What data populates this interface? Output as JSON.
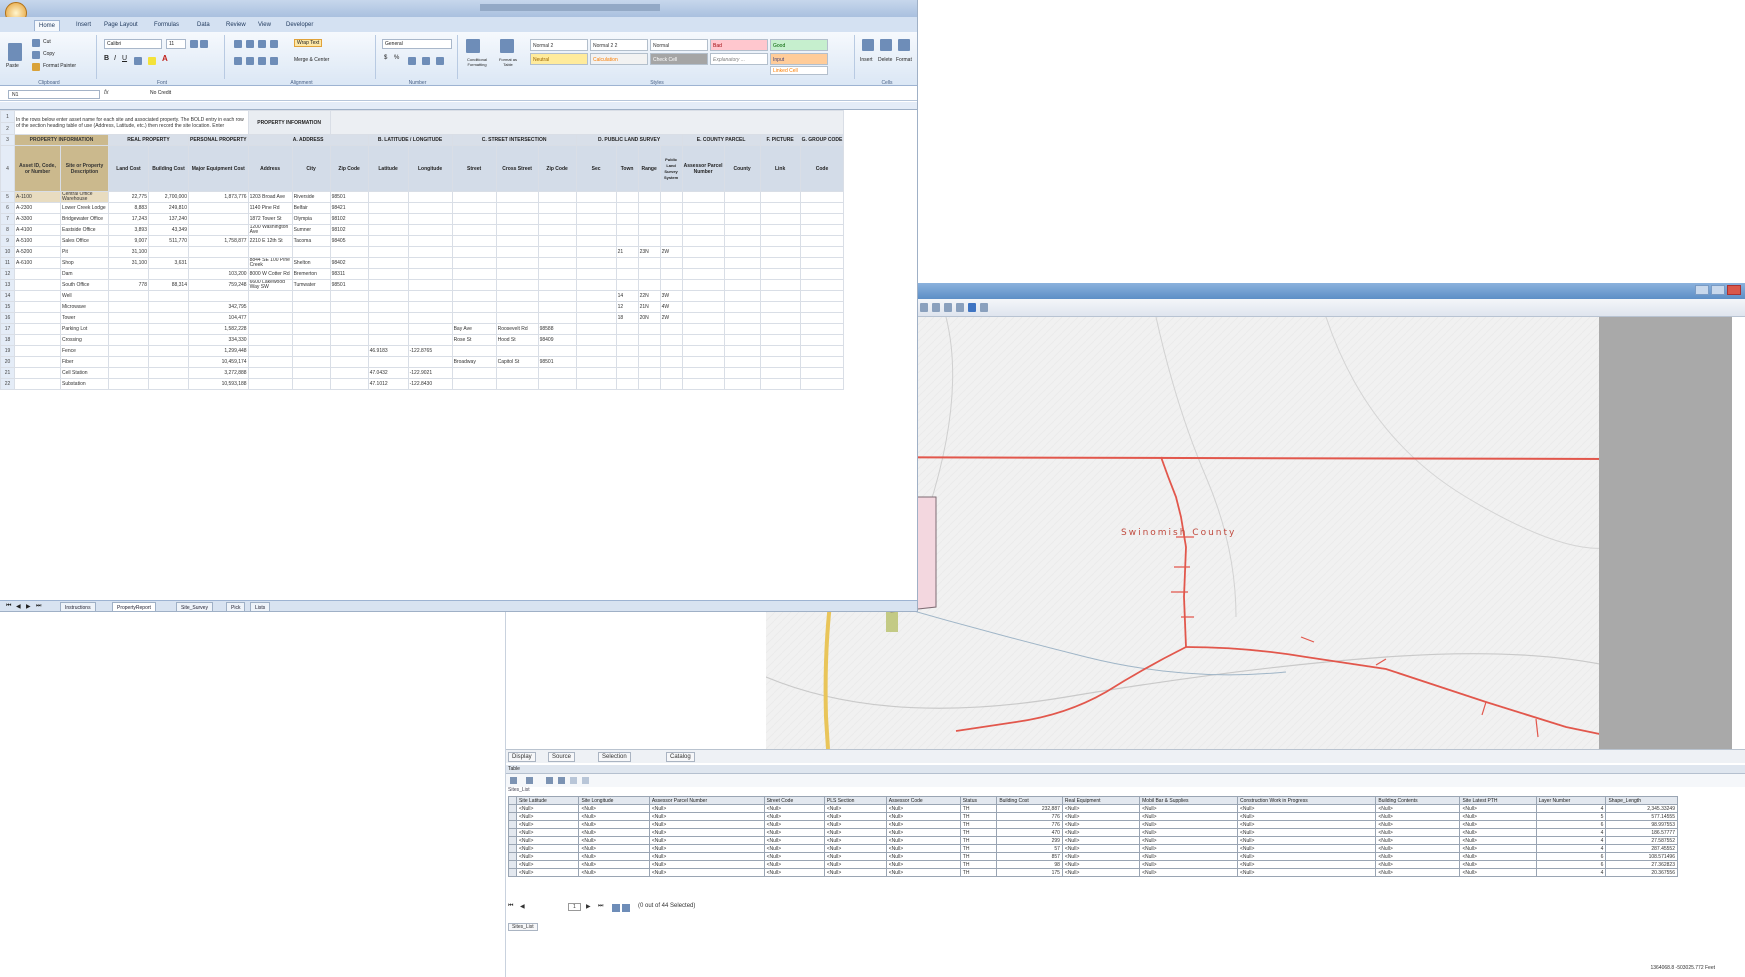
{
  "excel": {
    "tabs": [
      "Home",
      "Insert",
      "Page Layout",
      "Formulas",
      "Data",
      "Review",
      "View",
      "Developer"
    ],
    "ribbon_groups": [
      "Clipboard",
      "Font",
      "Alignment",
      "Number",
      "Styles",
      "Cells"
    ],
    "ribbon": {
      "cut": "Cut",
      "copy": "Copy",
      "format_painter": "Format Painter",
      "paste": "Paste",
      "font": "Calibri",
      "font_size": "11",
      "wrap_text": "Wrap Text",
      "merge_center": "Merge & Center",
      "number_format": "General",
      "conditional_formatting": "Conditional Formatting",
      "format_as_table": "Format as Table",
      "insert": "Insert",
      "delete": "Delete",
      "format": "Format",
      "styles": [
        "Normal 2",
        "Normal 2 2",
        "Normal",
        "Bad",
        "Good",
        "Neutral",
        "Calculation",
        "Check Cell",
        "Explanatory ...",
        "Input",
        "Linked Cell"
      ]
    },
    "namebox": "N1",
    "formula_value": "No Credit",
    "intro_text": "In the rows below enter asset name for each site and associated property. The BOLD entry in each row of the section heading table of use (Address, Latitude, etc.) then record the site location. Enter",
    "header_box": "PROPERTY INFORMATION",
    "grid": {
      "sections": [
        "PROPERTY INFORMATION",
        "REAL PROPERTY",
        "PERSONAL PROPERTY",
        "A. ADDRESS",
        "B. LATITUDE / LONGITUDE",
        "C. STREET INTERSECTION",
        "D. PUBLIC LAND SURVEY",
        "E. COUNTY PARCEL",
        "F. PICTURE",
        "G. GROUP CODE"
      ],
      "headers": [
        "Asset ID, Code, or Number",
        "Site or Property Description",
        "Land Cost",
        "Building Cost",
        "Major Equipment Cost",
        "Address",
        "City",
        "Zip Code",
        "Latitude",
        "Longitude",
        "Street",
        "Cross Street",
        "Zip Code",
        "Public Land Survey System",
        "Sec",
        "Town",
        "Range",
        "Assessor Parcel Number",
        "County",
        "Link",
        "Code"
      ],
      "rows": [
        [
          "A-1100",
          "Central Office Warehouse",
          "22,775",
          "2,700,000",
          "1,873,776",
          "1203 Broad Ave",
          "Riverside",
          "98501",
          "",
          "",
          "",
          "",
          "",
          "",
          "",
          "",
          "",
          "",
          "",
          "",
          ""
        ],
        [
          "A-2300",
          "Lower Creek Lodge",
          "8,883",
          "249,810",
          "",
          "1140 Pine Rd",
          "Belfair",
          "98421",
          "",
          "",
          "",
          "",
          "",
          "",
          "",
          "",
          "",
          "",
          "",
          "",
          ""
        ],
        [
          "A-3300",
          "Bridgewater Office",
          "17,243",
          "137,240",
          "",
          "1872 Tower St",
          "Olympia",
          "98102",
          "",
          "",
          "",
          "",
          "",
          "",
          "",
          "",
          "",
          "",
          "",
          "",
          ""
        ],
        [
          "A-4100",
          "Eastside Office",
          "3,893",
          "43,349",
          "",
          "1200 Washington Ave",
          "Sumner",
          "98102",
          "",
          "",
          "",
          "",
          "",
          "",
          "",
          "",
          "",
          "",
          "",
          "",
          ""
        ],
        [
          "A-5100",
          "Sales Office",
          "9,007",
          "511,770",
          "1,758,877",
          "2210 E 12th St",
          "Tacoma",
          "98405",
          "",
          "",
          "",
          "",
          "",
          "",
          "",
          "",
          "",
          "",
          "",
          "",
          ""
        ],
        [
          "A-5200",
          "Pit",
          "31,100",
          "",
          "",
          "",
          "",
          "",
          "",
          "",
          "",
          "",
          "",
          "",
          "21",
          "23N",
          "2W",
          "",
          "",
          "",
          ""
        ],
        [
          "A-6100",
          "Shop",
          "31,100",
          "3,631",
          "",
          "8844 SE 100 Pine Creek",
          "Shelton",
          "98402",
          "",
          "",
          "",
          "",
          "",
          "",
          "",
          "",
          "",
          "",
          "",
          "",
          ""
        ],
        [
          "",
          "Dam",
          "",
          "",
          "103,200",
          "8000 W Cotter Rd",
          "Bremerton",
          "98311",
          "",
          "",
          "",
          "",
          "",
          "",
          "",
          "",
          "",
          "",
          "",
          "",
          ""
        ],
        [
          "",
          "South Office",
          "778",
          "88,314",
          "759,248",
          "6600 Lakewood Way SW",
          "Tumwater",
          "98501",
          "",
          "",
          "",
          "",
          "",
          "",
          "",
          "",
          "",
          "",
          "",
          "",
          ""
        ],
        [
          "",
          "Well",
          "",
          "",
          "",
          "",
          "",
          "",
          "",
          "",
          "",
          "",
          "",
          "",
          "14",
          "22N",
          "3W",
          "",
          "",
          "",
          ""
        ],
        [
          "",
          "Microwave",
          "",
          "",
          "342,795",
          "",
          "",
          "",
          "",
          "",
          "",
          "",
          "",
          "",
          "12",
          "21N",
          "4W",
          "",
          "",
          "",
          ""
        ],
        [
          "",
          "Tower",
          "",
          "",
          "104,477",
          "",
          "",
          "",
          "",
          "",
          "",
          "",
          "",
          "",
          "18",
          "20N",
          "2W",
          "",
          "",
          "",
          ""
        ],
        [
          "",
          "Parking Lot",
          "",
          "",
          "1,582,228",
          "",
          "",
          "",
          "",
          "",
          "Bay Ave",
          "Roosevelt Rd",
          "98588",
          "",
          "",
          "",
          "",
          "",
          "",
          "",
          ""
        ],
        [
          "",
          "Crossing",
          "",
          "",
          "334,330",
          "",
          "",
          "",
          "",
          "",
          "Rose St",
          "Hood St",
          "98409",
          "",
          "",
          "",
          "",
          "",
          "",
          "",
          ""
        ],
        [
          "",
          "Fence",
          "",
          "",
          "1,299,448",
          "",
          "",
          "",
          "46.9183",
          "-122.8765",
          "",
          "",
          "",
          "",
          "",
          "",
          "",
          "",
          "",
          "",
          ""
        ],
        [
          "",
          "Fiber",
          "",
          "",
          "10,459,174",
          "",
          "",
          "",
          "",
          "",
          "Broadway",
          "Capitol St",
          "98501",
          "",
          "",
          "",
          "",
          "",
          "",
          "",
          ""
        ],
        [
          "",
          "Cell Station",
          "",
          "",
          "3,272,888",
          "",
          "",
          "",
          "47.0432",
          "-122.9021",
          "",
          "",
          "",
          "",
          "",
          "",
          "",
          "",
          "",
          "",
          ""
        ],
        [
          "",
          "Substation",
          "",
          "",
          "10,593,188",
          "",
          "",
          "",
          "47.1012",
          "-122.8430",
          "",
          "",
          "",
          "",
          "",
          "",
          "",
          "",
          "",
          "",
          ""
        ]
      ]
    },
    "sheet_tabs": [
      "Instructions",
      "PropertyReport",
      "Site_Survey",
      "Pick",
      "Lists"
    ]
  },
  "gis": {
    "map_label": "Swinomish County",
    "bottom_tabs": [
      "Display",
      "Source",
      "Selection",
      "Catalog"
    ],
    "table_title": "Table",
    "layer_name": "Sites_List",
    "columns": [
      "Site Latitude",
      "Site Longitude",
      "Assessor Parcel Number",
      "Street Code",
      "PLS Section",
      "Assessor Code",
      "Status",
      "Building Cost",
      "Real Equipment",
      "Mobil Bar & Supplies",
      "Construction Work in Progress",
      "Building Contents",
      "Site Latest PTH",
      "Layer Number",
      "Shape_Length"
    ],
    "table_rows": [
      [
        "<Null>",
        "<Null>",
        "<Null>",
        "<Null>",
        "<Null>",
        "<Null>",
        "TH",
        "232,887",
        "<Null>",
        "<Null>",
        "<Null>",
        "<Null>",
        "<Null>",
        "4",
        "2,345.33249"
      ],
      [
        "<Null>",
        "<Null>",
        "<Null>",
        "<Null>",
        "<Null>",
        "<Null>",
        "TH",
        "776",
        "<Null>",
        "<Null>",
        "<Null>",
        "<Null>",
        "<Null>",
        "5",
        "577.14555"
      ],
      [
        "<Null>",
        "<Null>",
        "<Null>",
        "<Null>",
        "<Null>",
        "<Null>",
        "TH",
        "776",
        "<Null>",
        "<Null>",
        "<Null>",
        "<Null>",
        "<Null>",
        "6",
        "98.997553"
      ],
      [
        "<Null>",
        "<Null>",
        "<Null>",
        "<Null>",
        "<Null>",
        "<Null>",
        "TH",
        "470",
        "<Null>",
        "<Null>",
        "<Null>",
        "<Null>",
        "<Null>",
        "4",
        "186.57777"
      ],
      [
        "<Null>",
        "<Null>",
        "<Null>",
        "<Null>",
        "<Null>",
        "<Null>",
        "TH",
        "299",
        "<Null>",
        "<Null>",
        "<Null>",
        "<Null>",
        "<Null>",
        "4",
        "27.587552"
      ],
      [
        "<Null>",
        "<Null>",
        "<Null>",
        "<Null>",
        "<Null>",
        "<Null>",
        "TH",
        "57",
        "<Null>",
        "<Null>",
        "<Null>",
        "<Null>",
        "<Null>",
        "4",
        "287.45552"
      ],
      [
        "<Null>",
        "<Null>",
        "<Null>",
        "<Null>",
        "<Null>",
        "<Null>",
        "TH",
        "857",
        "<Null>",
        "<Null>",
        "<Null>",
        "<Null>",
        "<Null>",
        "6",
        "108.571496"
      ],
      [
        "<Null>",
        "<Null>",
        "<Null>",
        "<Null>",
        "<Null>",
        "<Null>",
        "TH",
        "98",
        "<Null>",
        "<Null>",
        "<Null>",
        "<Null>",
        "<Null>",
        "6",
        "27.362823"
      ],
      [
        "<Null>",
        "<Null>",
        "<Null>",
        "<Null>",
        "<Null>",
        "<Null>",
        "TH",
        "175",
        "<Null>",
        "<Null>",
        "<Null>",
        "<Null>",
        "<Null>",
        "4",
        "20.367556"
      ]
    ],
    "nav_record": "1",
    "selection_text": "(0 out of 44 Selected)",
    "status": "1364068.8 -503025.772 Feet"
  }
}
